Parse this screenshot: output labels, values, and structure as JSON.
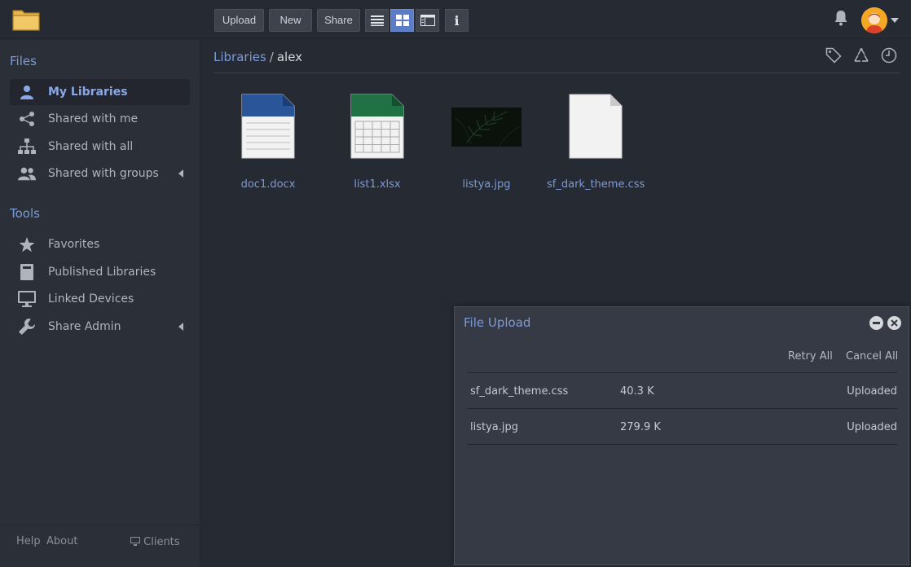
{
  "toolbar": {
    "upload_label": "Upload",
    "new_label": "New",
    "share_label": "Share",
    "views": [
      {
        "icon": "list-view-icon",
        "active": false
      },
      {
        "icon": "grid-view-icon",
        "active": true
      },
      {
        "icon": "column-view-icon",
        "active": false
      }
    ],
    "info_label": "i"
  },
  "sidebar": {
    "files_heading": "Files",
    "files_items": [
      {
        "label": "My Libraries",
        "icon": "user-icon",
        "active": true
      },
      {
        "label": "Shared with me",
        "icon": "share-nodes-icon"
      },
      {
        "label": "Shared with all",
        "icon": "org-chart-icon"
      },
      {
        "label": "Shared with groups",
        "icon": "group-icon",
        "expandable": true
      }
    ],
    "tools_heading": "Tools",
    "tools_items": [
      {
        "label": "Favorites",
        "icon": "star-icon"
      },
      {
        "label": "Published Libraries",
        "icon": "book-icon"
      },
      {
        "label": "Linked Devices",
        "icon": "monitor-icon"
      },
      {
        "label": "Share Admin",
        "icon": "wrench-icon",
        "expandable": true
      }
    ],
    "footer": {
      "help": "Help",
      "about": "About",
      "clients": "Clients"
    }
  },
  "breadcrumb": {
    "root": "Libraries",
    "separator": "/",
    "current": "alex"
  },
  "files": [
    {
      "name": "doc1.docx",
      "type": "word"
    },
    {
      "name": "list1.xlsx",
      "type": "excel"
    },
    {
      "name": "listya.jpg",
      "type": "image"
    },
    {
      "name": "sf_dark_theme.css",
      "type": "generic"
    }
  ],
  "upload_dialog": {
    "title": "File Upload",
    "retry_all": "Retry All",
    "cancel_all": "Cancel All",
    "rows": [
      {
        "name": "sf_dark_theme.css",
        "size": "40.3 K",
        "status": "Uploaded"
      },
      {
        "name": "listya.jpg",
        "size": "279.9 K",
        "status": "Uploaded"
      }
    ]
  },
  "colors": {
    "accent": "#7c9ad6",
    "background": "#262a33",
    "sidebar": "#2b2f38",
    "active_view": "#5b7cc6"
  }
}
